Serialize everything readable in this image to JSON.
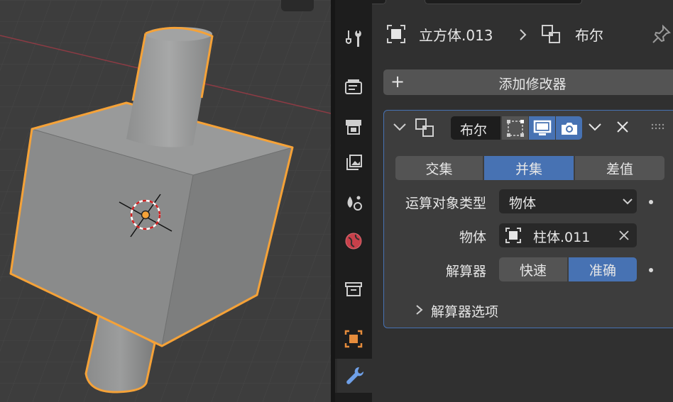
{
  "breadcrumb": {
    "object_name": "立方体.013",
    "modifier_name": "布尔",
    "pin_icon": "pin-icon"
  },
  "add_modifier": {
    "label": "添加修改器"
  },
  "modifier": {
    "name": "布尔",
    "operations": [
      "交集",
      "并集",
      "差值"
    ],
    "active_operation": "并集",
    "operand_type_label": "运算对象类型",
    "operand_type_value": "物体",
    "object_label": "物体",
    "object_value": "柱体.011",
    "solver_label": "解算器",
    "solvers": [
      "快速",
      "准确"
    ],
    "active_solver": "准确",
    "solver_options_label": "解算器选项"
  },
  "property_tabs": [
    "tool-icon",
    "render-icon",
    "output-icon",
    "view-layer-icon",
    "scene-icon",
    "world-icon",
    "collection-icon",
    "object-icon",
    "modifier-wrench-icon"
  ],
  "active_tab": "modifier-wrench-icon",
  "colors": {
    "accent_blue": "#4772b3",
    "selection_orange": "#f5a238",
    "panel_bg": "#3d3d3d",
    "editor_bg": "#303030"
  }
}
